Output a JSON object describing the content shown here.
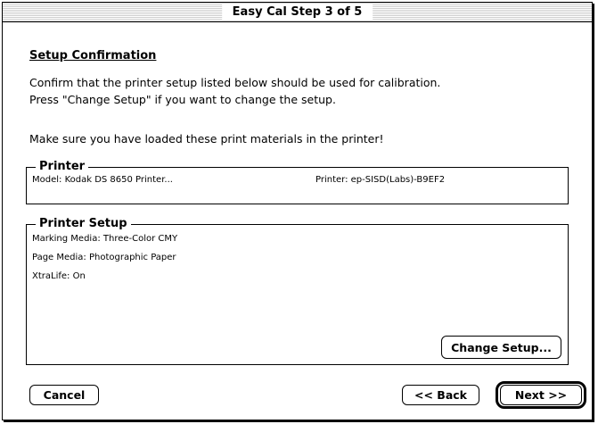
{
  "window": {
    "title": "Easy Cal Step 3 of 5"
  },
  "heading": "Setup Confirmation",
  "intro_line1": "Confirm that the printer setup listed below should be used for calibration.",
  "intro_line2": "Press \"Change Setup\" if you want to change the setup.",
  "instruction": "Make sure you have loaded these print materials in the printer!",
  "printer_group": {
    "label": "Printer",
    "model": "Model: Kodak DS 8650 Printer...",
    "printer": "Printer: ep-SISD(Labs)-B9EF2"
  },
  "setup_group": {
    "label": "Printer Setup",
    "marking_media": "Marking Media: Three-Color CMY",
    "page_media": "Page Media: Photographic Paper",
    "xtralife": "XtraLife: On",
    "change_setup_label": "Change Setup..."
  },
  "buttons": {
    "cancel": "Cancel",
    "back": "<< Back",
    "next": "Next >>"
  }
}
